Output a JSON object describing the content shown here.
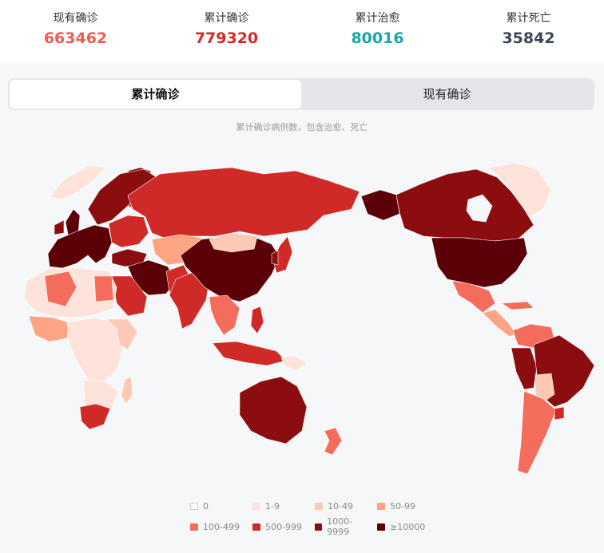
{
  "stats": [
    {
      "label": "现有确诊",
      "value": "663462",
      "color": "#f05b52"
    },
    {
      "label": "累计确诊",
      "value": "779320",
      "color": "#d42a2a"
    },
    {
      "label": "累计治愈",
      "value": "80016",
      "color": "#1aa6a6"
    },
    {
      "label": "累计死亡",
      "value": "35842",
      "color": "#3d4451"
    }
  ],
  "tabs": [
    {
      "label": "累计确诊",
      "active": true
    },
    {
      "label": "现有确诊",
      "active": false
    }
  ],
  "subtitle": "累计确诊病例数，包含治愈、死亡",
  "legend": [
    {
      "label": "0",
      "color": "#ffffff"
    },
    {
      "label": "1-9",
      "color": "#fde3da"
    },
    {
      "label": "10-49",
      "color": "#fdc8b4"
    },
    {
      "label": "50-99",
      "color": "#fca484"
    },
    {
      "label": "100-499",
      "color": "#f46c5b"
    },
    {
      "label": "500-999",
      "color": "#cf2a27"
    },
    {
      "label": "1000-9999",
      "color": "#8b0d0f"
    },
    {
      "label": "≥10000",
      "color": "#5a0006"
    }
  ]
}
